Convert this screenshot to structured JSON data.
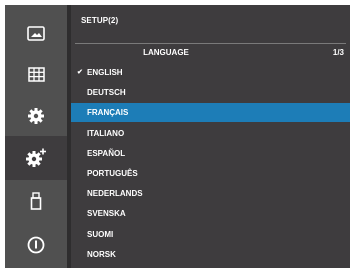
{
  "header": {
    "title": "SETUP(2)"
  },
  "section": {
    "title": "LANGUAGE",
    "page_indicator": "1/3"
  },
  "sidebar": {
    "items": [
      {
        "icon": "image-icon",
        "active": false
      },
      {
        "icon": "grid-icon",
        "active": false
      },
      {
        "icon": "gear-icon",
        "active": false
      },
      {
        "icon": "gear-plus-icon",
        "active": true
      },
      {
        "icon": "usb-icon",
        "active": false
      },
      {
        "icon": "power-icon",
        "active": false
      }
    ]
  },
  "languages": [
    {
      "label": "ENGLISH",
      "checked": true
    },
    {
      "label": "DEUTSCH"
    },
    {
      "label": "FRANÇAIS",
      "selected": true
    },
    {
      "label": "ITALIANO"
    },
    {
      "label": "ESPAÑOL"
    },
    {
      "label": "PORTUGUÊS"
    },
    {
      "label": "NEDERLANDS"
    },
    {
      "label": "SVENSKA"
    },
    {
      "label": "SUOMI"
    },
    {
      "label": "NORSK"
    }
  ],
  "colors": {
    "highlight": "#1d7db7",
    "background": "#3e3c3e",
    "sidebar": "#505050"
  }
}
